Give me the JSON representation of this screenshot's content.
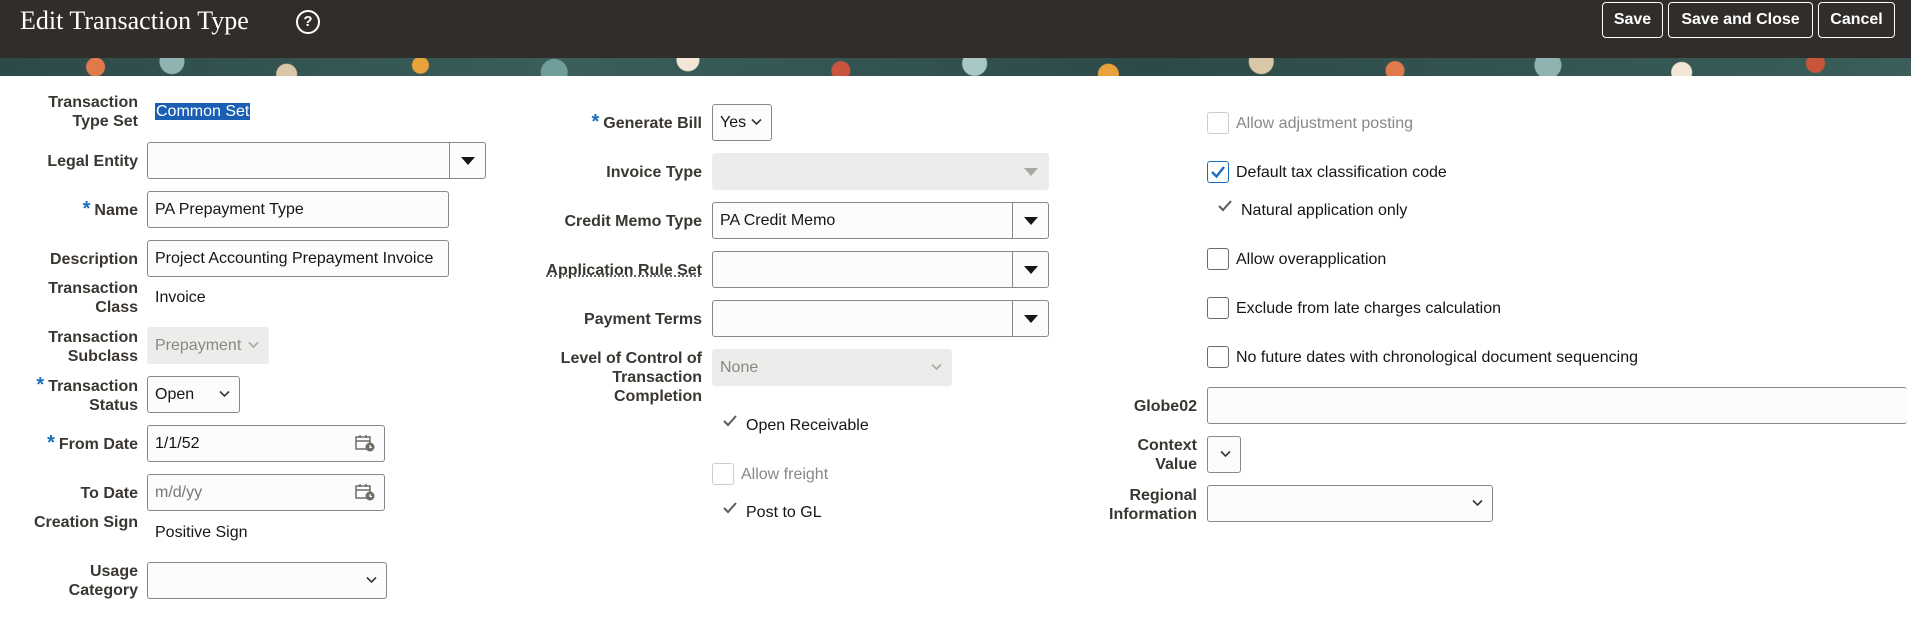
{
  "header": {
    "title": "Edit Transaction Type",
    "help_icon": "help-circle-icon",
    "save_label": "Save",
    "save_close_label": "Save and Close",
    "cancel_label": "Cancel"
  },
  "col1": {
    "transaction_type_set": {
      "label": "Transaction Type Set",
      "value": "Common Set"
    },
    "legal_entity": {
      "label": "Legal Entity",
      "value": ""
    },
    "name": {
      "label": "Name",
      "value": "PA Prepayment Type"
    },
    "description": {
      "label": "Description",
      "value": "Project Accounting Prepayment Invoice"
    },
    "transaction_class": {
      "label": "Transaction Class",
      "value": "Invoice"
    },
    "transaction_subclass": {
      "label": "Transaction Subclass",
      "value": "Prepayment"
    },
    "transaction_status": {
      "label": "Transaction Status",
      "value": "Open"
    },
    "from_date": {
      "label": "From Date",
      "value": "1/1/52"
    },
    "to_date": {
      "label": "To Date",
      "placeholder": "m/d/yy"
    },
    "creation_sign": {
      "label": "Creation Sign",
      "value": "Positive Sign"
    },
    "usage_category": {
      "label": "Usage Category",
      "value": ""
    }
  },
  "col2": {
    "generate_bill": {
      "label": "Generate Bill",
      "value": "Yes"
    },
    "invoice_type": {
      "label": "Invoice Type",
      "value": ""
    },
    "credit_memo_type": {
      "label": "Credit Memo Type",
      "value": "PA Credit Memo"
    },
    "application_rule_set": {
      "label": "Application Rule Set",
      "value": ""
    },
    "payment_terms": {
      "label": "Payment Terms",
      "value": ""
    },
    "level_of_control": {
      "label": "Level of Control of Transaction Completion",
      "value": "None"
    },
    "open_receivable": {
      "label": "Open Receivable",
      "checked": true
    },
    "allow_freight": {
      "label": "Allow freight",
      "checked": false
    },
    "post_to_gl": {
      "label": "Post to GL",
      "checked": true
    }
  },
  "col3": {
    "allow_adjustment_posting": {
      "label": "Allow adjustment posting",
      "checked": false
    },
    "default_tax_classification": {
      "label": "Default tax classification code",
      "checked": true
    },
    "natural_application_only": {
      "label": "Natural application only",
      "checked": true
    },
    "allow_overapplication": {
      "label": "Allow overapplication",
      "checked": false
    },
    "exclude_late_charges": {
      "label": "Exclude from late charges calculation",
      "checked": false
    },
    "no_future_dates": {
      "label": "No future dates with chronological document sequencing",
      "checked": false
    },
    "globe02": {
      "label": "Globe02",
      "value": ""
    },
    "context_value": {
      "label": "Context Value",
      "value": ""
    },
    "regional_information": {
      "label": "Regional Information",
      "value": ""
    }
  },
  "colors": {
    "header_bg": "#312d2a",
    "accent": "#1a6ec0",
    "required": "#1a6ec0"
  }
}
